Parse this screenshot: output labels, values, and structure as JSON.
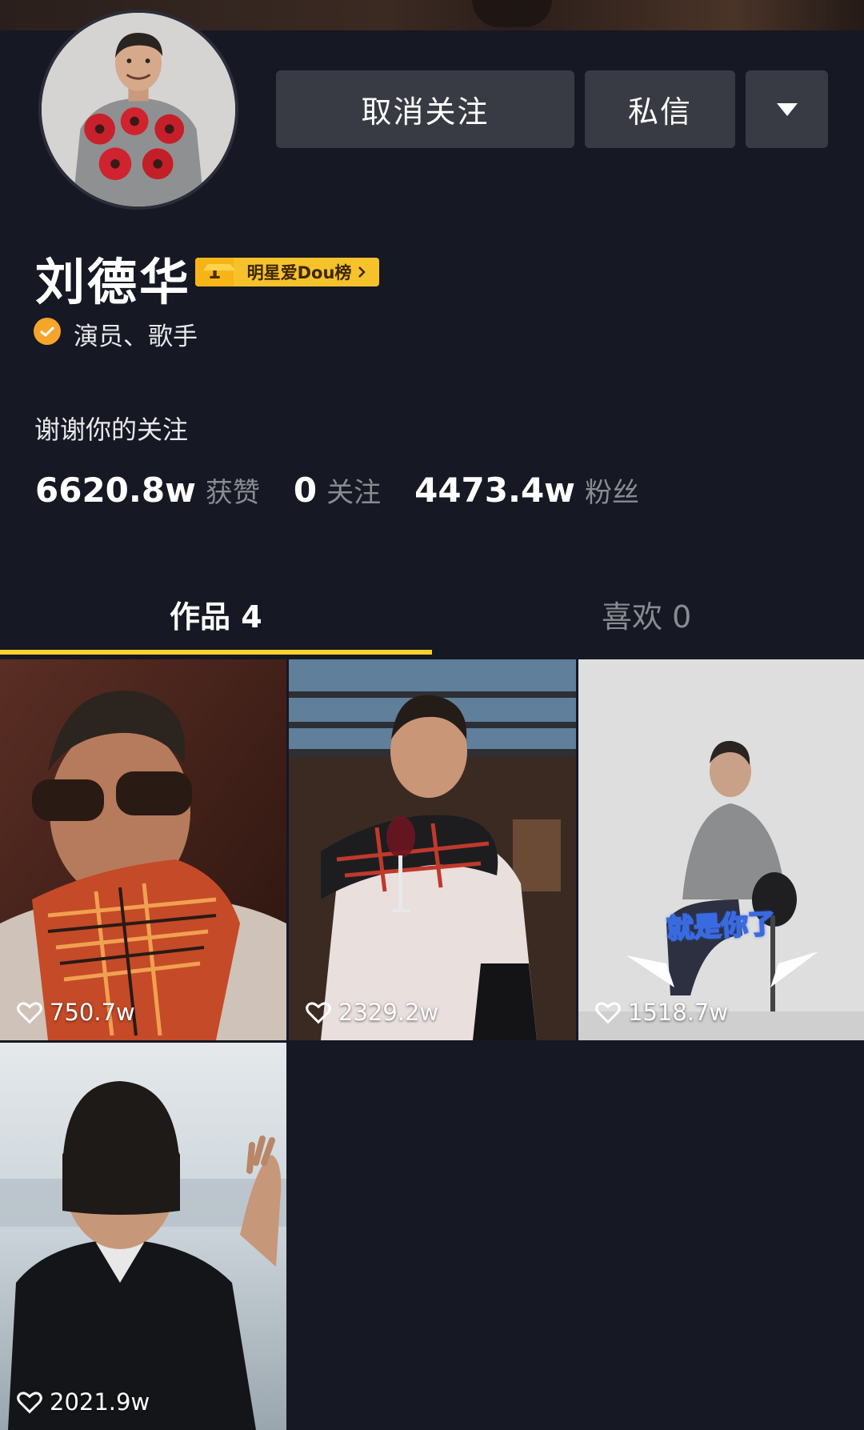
{
  "header": {
    "unfollow_label": "取消关注",
    "message_label": "私信"
  },
  "profile": {
    "name": "刘德华",
    "rank_number": "1",
    "rank_label": "明星爱Dou榜",
    "verified_text": "演员、歌手",
    "bio": "谢谢你的关注"
  },
  "stats": [
    {
      "value": "6620.8w",
      "label": "获赞"
    },
    {
      "value": "0",
      "label": "关注"
    },
    {
      "value": "4473.4w",
      "label": "粉丝"
    }
  ],
  "tabs": {
    "works": "作品 4",
    "likes": "喜欢 0"
  },
  "videos": [
    {
      "likes": "750.7w"
    },
    {
      "likes": "2329.2w"
    },
    {
      "likes": "1518.7w",
      "caption": "就是你了"
    },
    {
      "likes": "2021.9w"
    }
  ],
  "colors": {
    "background": "#161823",
    "button": "#393b44",
    "tab_indicator": "#fbd02b",
    "verified": "#f6a52b",
    "rank_badge": "#f5c22b"
  },
  "icons": [
    "chevron-down-icon",
    "verified-check-icon",
    "heart-icon",
    "chevron-right-icon"
  ]
}
